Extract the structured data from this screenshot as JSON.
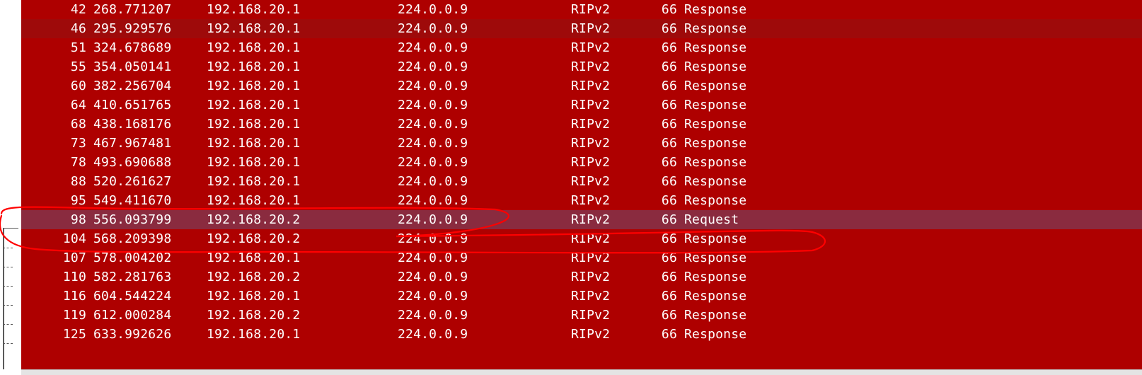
{
  "colors": {
    "row_bg": "#ae0000",
    "row_alt_bg": "#9e0a0a",
    "row_selected_bg": "#8a2b3f",
    "text": "#ffffff",
    "annotation_ink": "#ff0000"
  },
  "packets": [
    {
      "no": "42",
      "time": "268.771207",
      "src": "192.168.20.1",
      "dst": "224.0.0.9",
      "proto": "RIPv2",
      "len": "66",
      "info": "Response",
      "alt": false,
      "selected": false
    },
    {
      "no": "46",
      "time": "295.929576",
      "src": "192.168.20.1",
      "dst": "224.0.0.9",
      "proto": "RIPv2",
      "len": "66",
      "info": "Response",
      "alt": true,
      "selected": false
    },
    {
      "no": "51",
      "time": "324.678689",
      "src": "192.168.20.1",
      "dst": "224.0.0.9",
      "proto": "RIPv2",
      "len": "66",
      "info": "Response",
      "alt": false,
      "selected": false
    },
    {
      "no": "55",
      "time": "354.050141",
      "src": "192.168.20.1",
      "dst": "224.0.0.9",
      "proto": "RIPv2",
      "len": "66",
      "info": "Response",
      "alt": false,
      "selected": false
    },
    {
      "no": "60",
      "time": "382.256704",
      "src": "192.168.20.1",
      "dst": "224.0.0.9",
      "proto": "RIPv2",
      "len": "66",
      "info": "Response",
      "alt": false,
      "selected": false
    },
    {
      "no": "64",
      "time": "410.651765",
      "src": "192.168.20.1",
      "dst": "224.0.0.9",
      "proto": "RIPv2",
      "len": "66",
      "info": "Response",
      "alt": false,
      "selected": false
    },
    {
      "no": "68",
      "time": "438.168176",
      "src": "192.168.20.1",
      "dst": "224.0.0.9",
      "proto": "RIPv2",
      "len": "66",
      "info": "Response",
      "alt": false,
      "selected": false
    },
    {
      "no": "73",
      "time": "467.967481",
      "src": "192.168.20.1",
      "dst": "224.0.0.9",
      "proto": "RIPv2",
      "len": "66",
      "info": "Response",
      "alt": false,
      "selected": false
    },
    {
      "no": "78",
      "time": "493.690688",
      "src": "192.168.20.1",
      "dst": "224.0.0.9",
      "proto": "RIPv2",
      "len": "66",
      "info": "Response",
      "alt": false,
      "selected": false
    },
    {
      "no": "88",
      "time": "520.261627",
      "src": "192.168.20.1",
      "dst": "224.0.0.9",
      "proto": "RIPv2",
      "len": "66",
      "info": "Response",
      "alt": false,
      "selected": false
    },
    {
      "no": "95",
      "time": "549.411670",
      "src": "192.168.20.1",
      "dst": "224.0.0.9",
      "proto": "RIPv2",
      "len": "66",
      "info": "Response",
      "alt": false,
      "selected": false
    },
    {
      "no": "98",
      "time": "556.093799",
      "src": "192.168.20.2",
      "dst": "224.0.0.9",
      "proto": "RIPv2",
      "len": "66",
      "info": "Request",
      "alt": false,
      "selected": true
    },
    {
      "no": "104",
      "time": "568.209398",
      "src": "192.168.20.2",
      "dst": "224.0.0.9",
      "proto": "RIPv2",
      "len": "66",
      "info": "Response",
      "alt": false,
      "selected": false
    },
    {
      "no": "107",
      "time": "578.004202",
      "src": "192.168.20.1",
      "dst": "224.0.0.9",
      "proto": "RIPv2",
      "len": "66",
      "info": "Response",
      "alt": false,
      "selected": false
    },
    {
      "no": "110",
      "time": "582.281763",
      "src": "192.168.20.2",
      "dst": "224.0.0.9",
      "proto": "RIPv2",
      "len": "66",
      "info": "Response",
      "alt": false,
      "selected": false
    },
    {
      "no": "116",
      "time": "604.544224",
      "src": "192.168.20.1",
      "dst": "224.0.0.9",
      "proto": "RIPv2",
      "len": "66",
      "info": "Response",
      "alt": false,
      "selected": false
    },
    {
      "no": "119",
      "time": "612.000284",
      "src": "192.168.20.2",
      "dst": "224.0.0.9",
      "proto": "RIPv2",
      "len": "66",
      "info": "Response",
      "alt": false,
      "selected": false
    },
    {
      "no": "125",
      "time": "633.992626",
      "src": "192.168.20.1",
      "dst": "224.0.0.9",
      "proto": "RIPv2",
      "len": "66",
      "info": "Response",
      "alt": false,
      "selected": false
    }
  ]
}
